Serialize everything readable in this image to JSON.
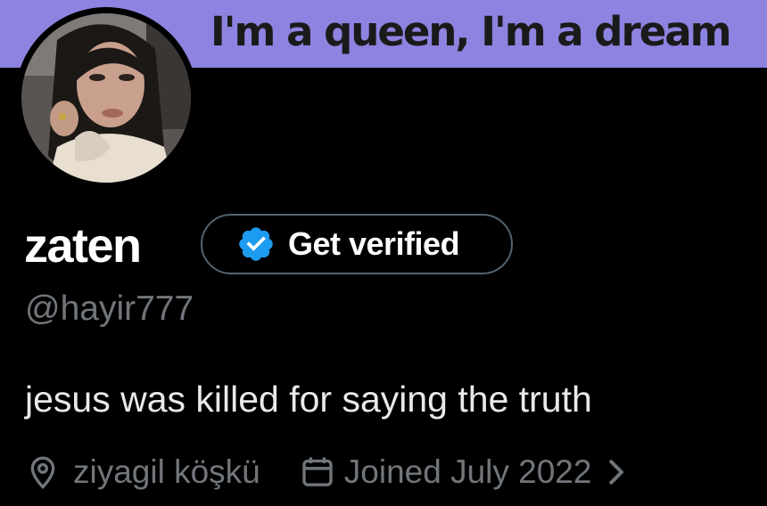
{
  "banner": {
    "text": "I'm a queen, I'm a dream",
    "color": "#8d83e0"
  },
  "profile": {
    "avatar_icon": "avatar-photo",
    "display_name": "zaten",
    "handle": "@hayir777",
    "bio": "jesus was killed for saying the truth"
  },
  "verify_button": {
    "label": "Get verified",
    "icon": "verified-badge-icon",
    "badge_color": "#1d9bf0"
  },
  "meta": {
    "location_icon": "location-pin-icon",
    "location": "ziyagil köşkü",
    "calendar_icon": "calendar-icon",
    "joined": "Joined July 2022",
    "chevron_icon": "chevron-right-icon"
  },
  "colors": {
    "background": "#000000",
    "primary_text": "#e7e9ea",
    "secondary_text": "#71767b",
    "border": "#536471"
  }
}
